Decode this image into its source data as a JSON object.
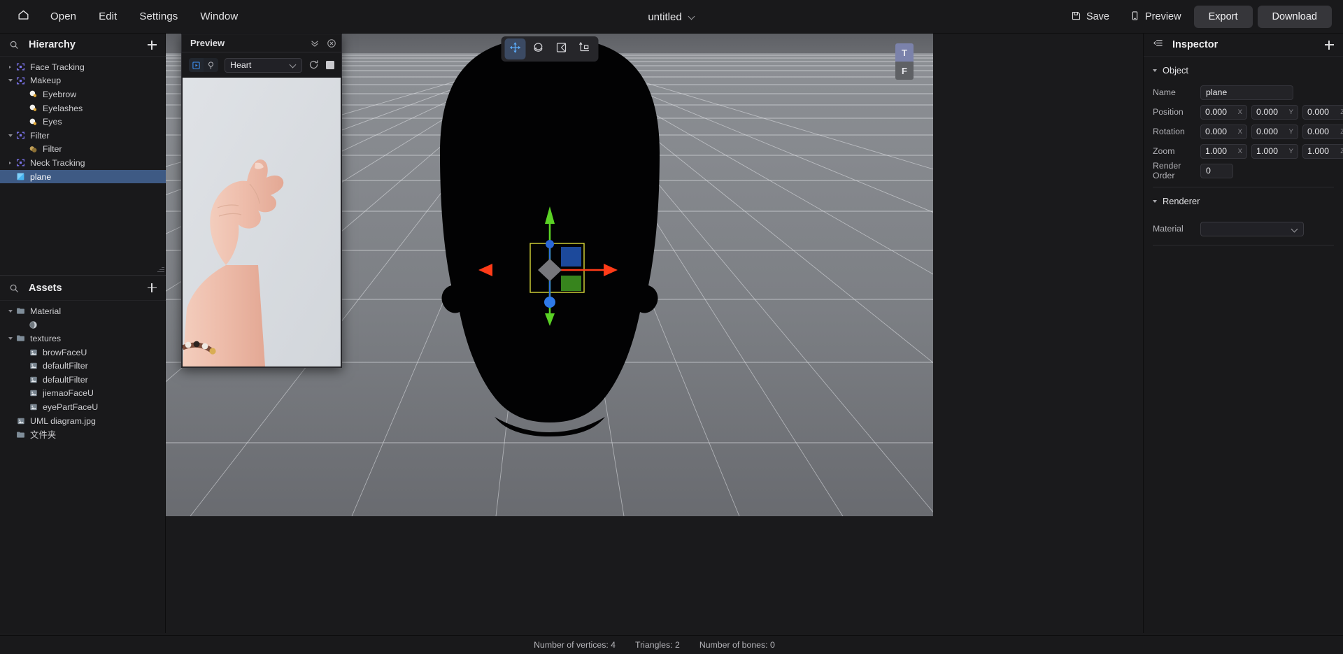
{
  "topbar": {
    "home_icon": "home-icon",
    "menus": [
      "Open",
      "Edit",
      "Settings",
      "Window"
    ],
    "document_title": "untitled",
    "actions": [
      {
        "label": "Save",
        "icon": "save-icon"
      },
      {
        "label": "Preview",
        "icon": "phone-preview-icon"
      }
    ],
    "buttons": [
      {
        "label": "Export"
      },
      {
        "label": "Download"
      }
    ]
  },
  "hierarchy": {
    "title": "Hierarchy",
    "search_icon": "search-icon",
    "add_icon": "plus-icon",
    "items": [
      {
        "label": "Face Tracking",
        "depth": 0,
        "icon": "node-icon",
        "twisty": "collapsed",
        "selected": false
      },
      {
        "label": "Makeup",
        "depth": 0,
        "icon": "node-icon",
        "twisty": "expanded",
        "selected": false
      },
      {
        "label": "Eyebrow",
        "depth": 1,
        "icon": "makeup-icon",
        "twisty": "none",
        "selected": false
      },
      {
        "label": "Eyelashes",
        "depth": 1,
        "icon": "makeup-icon",
        "twisty": "none",
        "selected": false
      },
      {
        "label": "Eyes",
        "depth": 1,
        "icon": "makeup-icon",
        "twisty": "none",
        "selected": false
      },
      {
        "label": "Filter",
        "depth": 0,
        "icon": "node-icon",
        "twisty": "expanded",
        "selected": false
      },
      {
        "label": "Filter",
        "depth": 1,
        "icon": "filter-icon",
        "twisty": "none",
        "selected": false
      },
      {
        "label": "Neck Tracking",
        "depth": 0,
        "icon": "node-icon",
        "twisty": "collapsed",
        "selected": false
      },
      {
        "label": "plane",
        "depth": 0,
        "icon": "plane-icon",
        "twisty": "none",
        "selected": true
      }
    ]
  },
  "assets": {
    "title": "Assets",
    "search_icon": "search-icon",
    "add_icon": "plus-icon",
    "items": [
      {
        "label": "Material",
        "depth": 0,
        "icon": "folder-icon",
        "twisty": "expanded"
      },
      {
        "label": "",
        "depth": 1,
        "icon": "material-sphere-icon",
        "twisty": "none"
      },
      {
        "label": "textures",
        "depth": 0,
        "icon": "folder-icon",
        "twisty": "expanded"
      },
      {
        "label": "browFaceU",
        "depth": 1,
        "icon": "image-icon",
        "twisty": "none"
      },
      {
        "label": "defaultFilter",
        "depth": 1,
        "icon": "image-icon",
        "twisty": "none"
      },
      {
        "label": "defaultFilter",
        "depth": 1,
        "icon": "image-icon",
        "twisty": "none"
      },
      {
        "label": "jiemaoFaceU",
        "depth": 1,
        "icon": "image-icon",
        "twisty": "none"
      },
      {
        "label": "eyePartFaceU",
        "depth": 1,
        "icon": "image-icon",
        "twisty": "none"
      },
      {
        "label": "UML diagram.jpg",
        "depth": 0,
        "icon": "image-icon",
        "twisty": "none"
      },
      {
        "label": "文件夹",
        "depth": 0,
        "icon": "folder-icon",
        "twisty": "none"
      }
    ]
  },
  "preview": {
    "title": "Preview",
    "collapse_icon": "chevrons-down-icon",
    "close_icon": "close-circle-icon",
    "mode_video_icon": "video-play-icon",
    "mode_camera_icon": "camera-icon",
    "effect_selected": "Heart",
    "effect_options": [
      "Heart"
    ],
    "refresh_icon": "refresh-icon",
    "stop_icon": "stop-square-icon",
    "image_alt": "hand-finger-heart-gesture"
  },
  "viewport": {
    "tools": [
      {
        "name": "move-tool",
        "icon": "move-arrows-icon",
        "active": true
      },
      {
        "name": "rotate-tool",
        "icon": "rotate-icon",
        "active": false
      },
      {
        "name": "scale-tool",
        "icon": "scale-icon",
        "active": false
      },
      {
        "name": "transform-tool",
        "icon": "axis-transform-icon",
        "active": false
      }
    ],
    "view_gizmo": {
      "top_label": "T",
      "front_label": "F",
      "active": "T"
    },
    "gizmo_colors": {
      "x": "#ff3b18",
      "y": "#5ad125",
      "z": "#2f6fdd",
      "bounds": "#d9d93a"
    }
  },
  "inspector": {
    "title": "Inspector",
    "menu_icon": "list-indent-icon",
    "add_icon": "plus-icon",
    "sections": [
      {
        "name": "Object",
        "fields": {
          "name_label": "Name",
          "name_value": "plane",
          "position_label": "Position",
          "position": {
            "x": "0.000",
            "y": "0.000",
            "z": "0.000"
          },
          "rotation_label": "Rotation",
          "rotation": {
            "x": "0.000",
            "y": "0.000",
            "z": "0.000"
          },
          "zoom_label": "Zoom",
          "zoom": {
            "x": "1.000",
            "y": "1.000",
            "z": "1.000"
          },
          "render_order_label": "Render Order",
          "render_order_value": "0"
        }
      },
      {
        "name": "Renderer",
        "fields": {
          "material_label": "Material",
          "material_value": ""
        }
      }
    ],
    "axis_labels": {
      "x": "X",
      "y": "Y",
      "z": "Z"
    }
  },
  "statusbar": {
    "vertices": "Number of vertices: 4",
    "triangles": "Triangles: 2",
    "bones": "Number of bones: 0"
  },
  "colors": {
    "accent_blue": "#3e5a84",
    "panel_bg": "#19191b",
    "viewport_bg": "#6d6f73",
    "node_purple": "#6b63d8"
  }
}
